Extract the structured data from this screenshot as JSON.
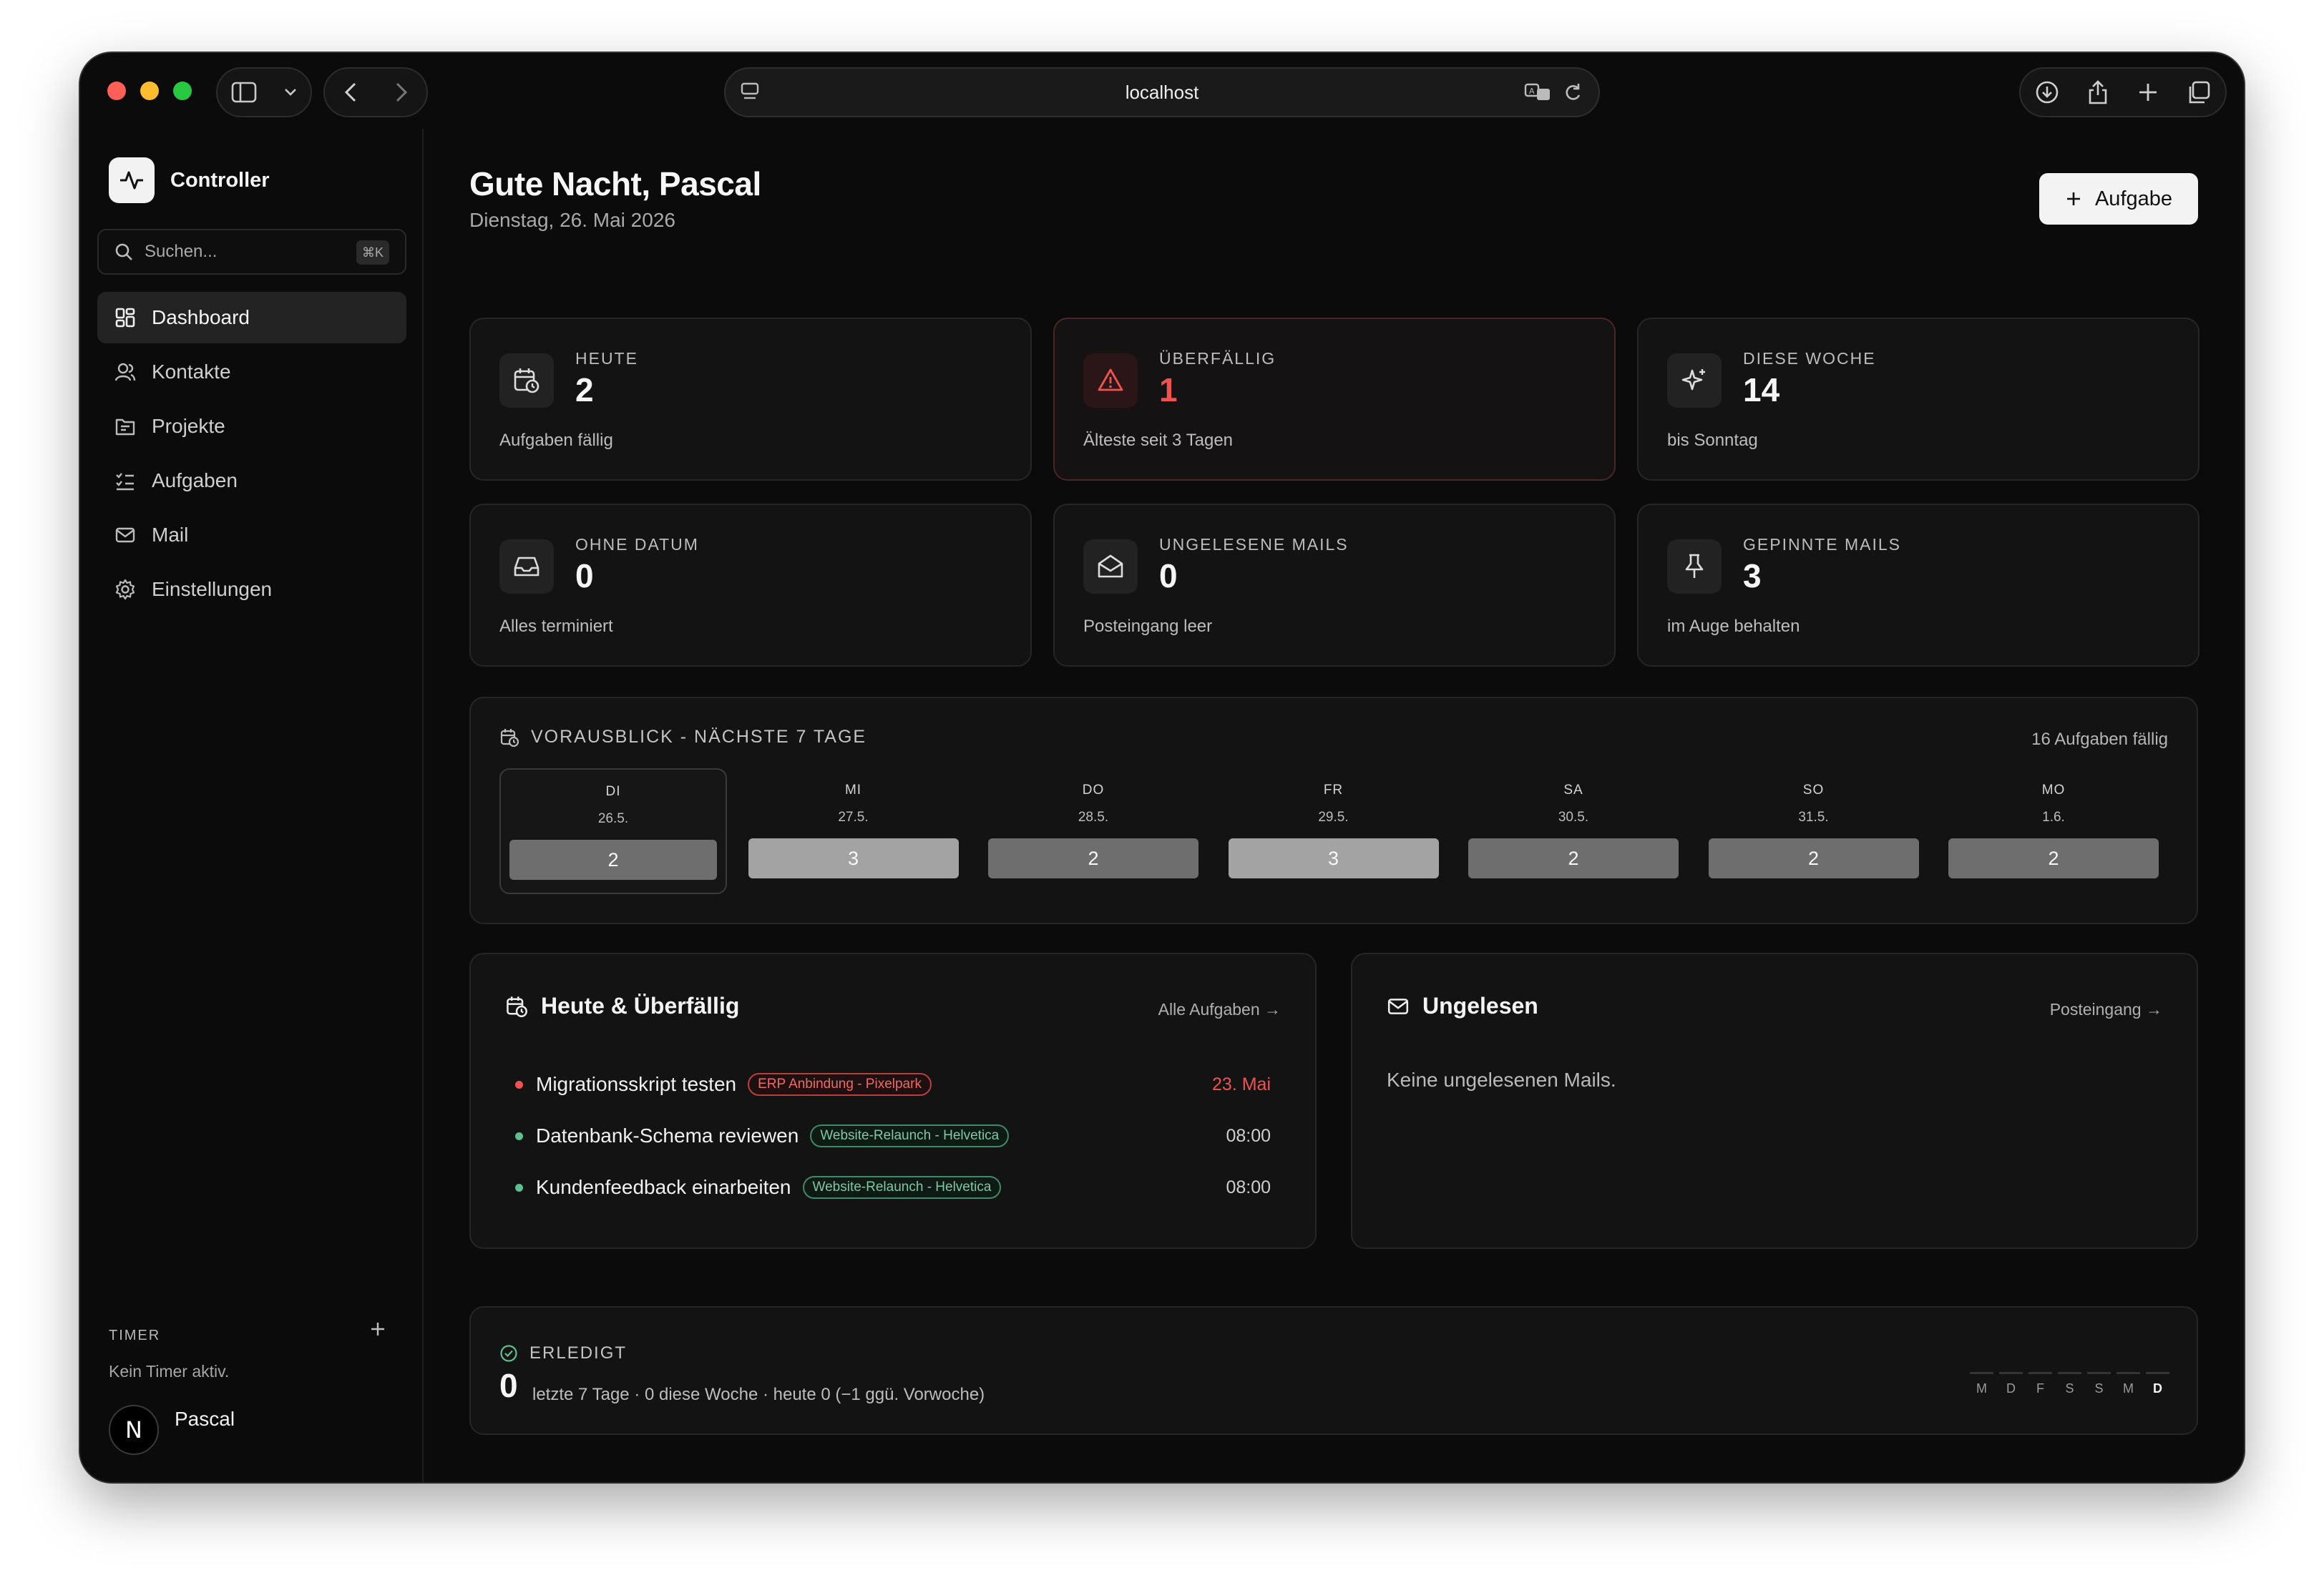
{
  "browser": {
    "url": "localhost"
  },
  "brand": {
    "name": "Controller"
  },
  "search": {
    "placeholder": "Suchen...",
    "shortcut": "⌘K"
  },
  "nav": [
    {
      "label": "Dashboard",
      "icon": "dashboard-icon",
      "active": true
    },
    {
      "label": "Kontakte",
      "icon": "contacts-icon"
    },
    {
      "label": "Projekte",
      "icon": "projects-icon"
    },
    {
      "label": "Aufgaben",
      "icon": "tasks-icon"
    },
    {
      "label": "Mail",
      "icon": "mail-icon"
    },
    {
      "label": "Einstellungen",
      "icon": "settings-icon"
    }
  ],
  "timer": {
    "label": "TIMER",
    "status": "Kein Timer aktiv."
  },
  "user": {
    "name": "Pascal",
    "initial": "N"
  },
  "header": {
    "greeting": "Gute Nacht, Pascal",
    "date": "Dienstag, 26. Mai 2026",
    "add_task_label": "Aufgabe"
  },
  "stats": [
    {
      "label": "HEUTE",
      "value": "2",
      "sub": "Aufgaben fällig",
      "icon": "calendar-clock-icon"
    },
    {
      "label": "ÜBERFÄLLIG",
      "value": "1",
      "sub": "Älteste seit 3 Tagen",
      "icon": "warning-icon"
    },
    {
      "label": "DIESE WOCHE",
      "value": "14",
      "sub": "bis Sonntag",
      "icon": "sparkle-icon"
    },
    {
      "label": "OHNE DATUM",
      "value": "0",
      "sub": "Alles terminiert",
      "icon": "inbox-icon"
    },
    {
      "label": "UNGELESENE MAILS",
      "value": "0",
      "sub": "Posteingang leer",
      "icon": "mail-open-icon"
    },
    {
      "label": "GEPINNTE MAILS",
      "value": "3",
      "sub": "im Auge behalten",
      "icon": "pin-icon"
    }
  ],
  "outlook": {
    "title": "VORAUSBLICK - NÄCHSTE 7 TAGE",
    "count": "16 Aufgaben fällig",
    "days": [
      {
        "name": "DI",
        "date": "26.5.",
        "count": "2",
        "selected": true
      },
      {
        "name": "MI",
        "date": "27.5.",
        "count": "3"
      },
      {
        "name": "DO",
        "date": "28.5.",
        "count": "2"
      },
      {
        "name": "FR",
        "date": "29.5.",
        "count": "3"
      },
      {
        "name": "SA",
        "date": "30.5.",
        "count": "2"
      },
      {
        "name": "SO",
        "date": "31.5.",
        "count": "2"
      },
      {
        "name": "MO",
        "date": "1.6.",
        "count": "2"
      }
    ]
  },
  "today_panel": {
    "title": "Heute & Überfällig",
    "link": "Alle Aufgaben →",
    "tasks": [
      {
        "title": "Migrationsskript testen",
        "tag": "ERP Anbindung - Pixelpark",
        "time": "23. Mai",
        "overdue": true
      },
      {
        "title": "Datenbank-Schema reviewen",
        "tag": "Website-Relaunch - Helvetica",
        "time": "08:00"
      },
      {
        "title": "Kundenfeedback einarbeiten",
        "tag": "Website-Relaunch - Helvetica",
        "time": "08:00"
      }
    ]
  },
  "unread_panel": {
    "title": "Ungelesen",
    "link": "Posteingang →",
    "empty": "Keine ungelesenen Mails."
  },
  "done": {
    "title": "ERLEDIGT",
    "value": "0",
    "text": "letzte 7 Tage · 0 diese Woche · heute 0 (−1 ggü. Vorwoche)",
    "spark_days": [
      "M",
      "D",
      "F",
      "S",
      "S",
      "M",
      "D"
    ]
  },
  "colors": {
    "overdue": "#ef5350",
    "task_ok": "#5cc08f",
    "bar_light": "#a3a3a3",
    "bar_dark": "#6e6e6e"
  }
}
